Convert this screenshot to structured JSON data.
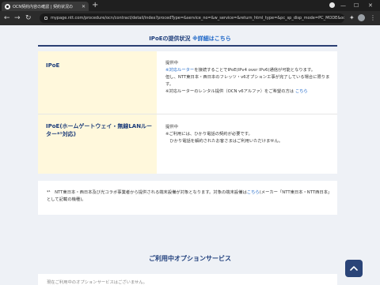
{
  "browser": {
    "tab_title": "OCN契約内容の確認 | 契約状況の",
    "url": "mypage.ntt.com/procedure/ocn/contract/detail/index?procedType=&service_no=&w_service=&return_html_type=&pc_sp_disp_mode=PC_MODE&oc..."
  },
  "ipoe_section": {
    "title": "IPoEの提供状況",
    "detail_link": "※詳細はこちら"
  },
  "table": {
    "rows": [
      {
        "label": "IPoE",
        "lines": [
          {
            "text": "提供中"
          },
          {
            "link": "※対応ルーター",
            "text": "を接続することでIPoE(IPv4 over IPv6)通信が可能となります。"
          },
          {
            "text": "但し、NTT東日本・西日本のフレッツ・v6オプション工事が完了している場合に限ります。"
          },
          {
            "text": "※対応ルーターのレンタル提供（OCN v6アルファ）をご希望の方は",
            "link_after": "こちら"
          }
        ]
      },
      {
        "label": "IPoE(ホームゲートウェイ・無線LANルーター*¹対応)",
        "lines": [
          {
            "text": "提供中"
          },
          {
            "text": "※ご利用には、ひかり電話の契約が必要です。"
          },
          {
            "text": "　ひかり電話を解約されたお客さまはご利用いただけません。"
          }
        ]
      }
    ]
  },
  "note": {
    "prefix": "*¹　NTT東日本・西日本及び光コラボ事業者から提供される端末設備が対象となります。対象の端末設備は",
    "link": "こちら",
    "suffix": "(メーカー「NTT東日本・NTT西日本」として記載の機種)。"
  },
  "options_section": {
    "title": "ご利用中オプションサービス",
    "text": "現在ご利用中のオプションサービスはございません。"
  },
  "icons": {
    "scroll_top": "chevron-up-icon"
  },
  "colors": {
    "navy": "#1c3c7a",
    "link": "#1b65c7",
    "header_bg": "#fff8dc",
    "scroll_btn": "#2a4478"
  }
}
